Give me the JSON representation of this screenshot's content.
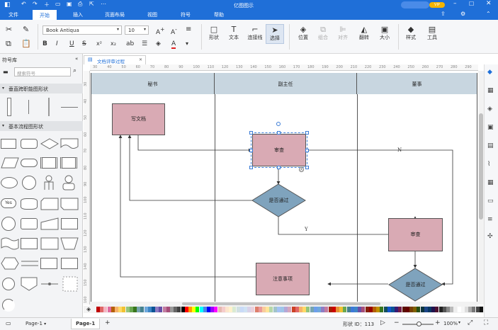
{
  "window": {
    "title": "亿图图示"
  },
  "menu": {
    "items": [
      "文件",
      "开始",
      "插入",
      "页面布局",
      "视图",
      "符号",
      "帮助"
    ]
  },
  "ribbon": {
    "font_family": "Book Antiqua",
    "font_size": "10",
    "groups": {
      "shape": "形状",
      "text": "文本",
      "connector": "连接线",
      "select": "选择",
      "position": "位置",
      "group": "组合",
      "align": "对齐",
      "flip": "翻转",
      "size": "大小",
      "style": "样式",
      "tools": "工具"
    }
  },
  "sidebar": {
    "title": "符号库",
    "search_placeholder": "搜索符号",
    "sections": [
      "垂直跨职能图形状",
      "基本流程图形状"
    ],
    "yes_label": "Yes"
  },
  "document": {
    "tab_label": "文档评审过程"
  },
  "ruler": {
    "h_ticks": [
      "30",
      "40",
      "50",
      "60",
      "70",
      "80",
      "90",
      "100",
      "110",
      "120",
      "130",
      "140",
      "150",
      "160",
      "170",
      "180",
      "190",
      "200",
      "210",
      "220",
      "230",
      "240",
      "250",
      "260",
      "270",
      "280",
      "290"
    ],
    "v_ticks": [
      "30",
      "40",
      "50",
      "60",
      "70",
      "80",
      "90",
      "100",
      "110",
      "120",
      "130",
      "140",
      "150",
      "160"
    ]
  },
  "diagram": {
    "lanes": [
      "秘书",
      "副主任",
      "董事"
    ],
    "nodes": {
      "write_doc": "写文档",
      "review1": "审查",
      "decision1": "是否通过",
      "review2": "审查",
      "decision2": "是否通过",
      "notes": "注意事项"
    },
    "labels": {
      "no": "N",
      "yes": "Y"
    }
  },
  "status": {
    "page_tab_1": "Page-1",
    "page_tab_2": "Page-1",
    "shape_id": "形状 ID：113",
    "zoom": "100%"
  },
  "colors": {
    "accent": "#1f6fd8",
    "node_fill": "#d9aab4",
    "decision_fill": "#7fa3bd",
    "lane_fill": "#c8d6e0"
  }
}
